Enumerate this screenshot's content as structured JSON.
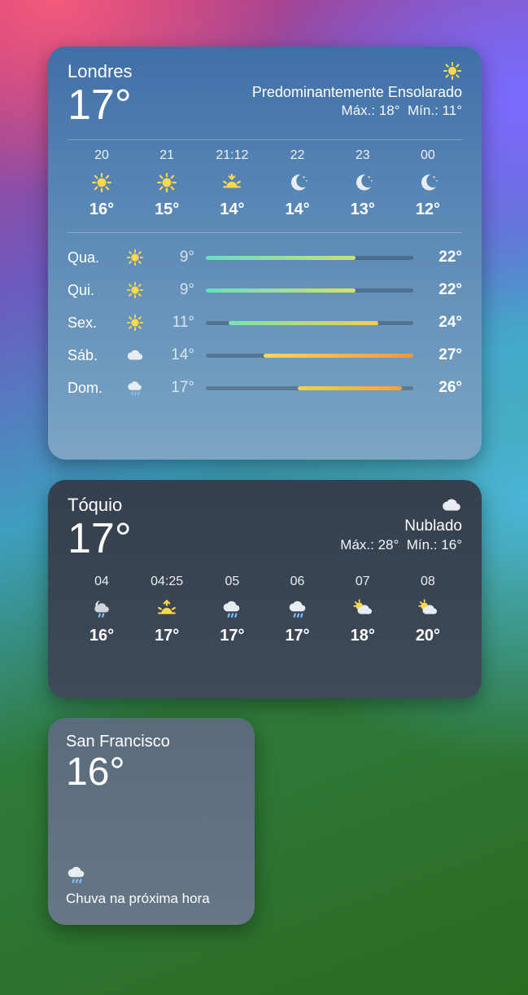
{
  "widgets": {
    "london": {
      "location": "Londres",
      "temp": "17°",
      "condition": "Predominantemente Ensolarado",
      "hi_label": "Máx.:",
      "hi": "18°",
      "lo_label": "Mín.:",
      "lo": "11°",
      "icon": "sun",
      "hourly": [
        {
          "time": "20",
          "icon": "sun",
          "temp": "16°"
        },
        {
          "time": "21",
          "icon": "sun",
          "temp": "15°"
        },
        {
          "time": "21:12",
          "icon": "sunset",
          "temp": "14°"
        },
        {
          "time": "22",
          "icon": "moon-stars",
          "temp": "14°"
        },
        {
          "time": "23",
          "icon": "moon-stars",
          "temp": "13°"
        },
        {
          "time": "00",
          "icon": "moon-stars",
          "temp": "12°"
        }
      ],
      "daily_range": {
        "min": 9,
        "max": 27
      },
      "daily": [
        {
          "day": "Qua.",
          "icon": "sun",
          "lo": "9°",
          "lo_n": 9,
          "hi": "22°",
          "hi_n": 22,
          "grad": [
            "#67dfc2",
            "#c8e077"
          ]
        },
        {
          "day": "Qui.",
          "icon": "sun",
          "lo": "9°",
          "lo_n": 9,
          "hi": "22°",
          "hi_n": 22,
          "grad": [
            "#67dfc2",
            "#d6e06a"
          ]
        },
        {
          "day": "Sex.",
          "icon": "sun",
          "lo": "11°",
          "lo_n": 11,
          "hi": "24°",
          "hi_n": 24,
          "grad": [
            "#78e2b5",
            "#f3cf4a"
          ]
        },
        {
          "day": "Sáb.",
          "icon": "cloud",
          "lo": "14°",
          "lo_n": 14,
          "hi": "27°",
          "hi_n": 27,
          "grad": [
            "#f7d85a",
            "#f6953a"
          ]
        },
        {
          "day": "Dom.",
          "icon": "cloud-rain",
          "lo": "17°",
          "lo_n": 17,
          "hi": "26°",
          "hi_n": 26,
          "grad": [
            "#f7cf55",
            "#f6a23a"
          ]
        }
      ]
    },
    "tokyo": {
      "location": "Tóquio",
      "temp": "17°",
      "condition": "Nublado",
      "hi_label": "Máx.:",
      "hi": "28°",
      "lo_label": "Mín.:",
      "lo": "16°",
      "icon": "cloud",
      "hourly": [
        {
          "time": "04",
          "icon": "moon-cloud-rain",
          "temp": "16°"
        },
        {
          "time": "04:25",
          "icon": "sunrise",
          "temp": "17°"
        },
        {
          "time": "05",
          "icon": "cloud-rain",
          "temp": "17°"
        },
        {
          "time": "06",
          "icon": "cloud-rain",
          "temp": "17°"
        },
        {
          "time": "07",
          "icon": "sun-cloud",
          "temp": "18°"
        },
        {
          "time": "08",
          "icon": "sun-cloud",
          "temp": "20°"
        }
      ]
    },
    "sf": {
      "location": "San Francisco",
      "temp": "16°",
      "icon": "cloud-rain",
      "condition": "Chuva na próxima hora"
    }
  }
}
